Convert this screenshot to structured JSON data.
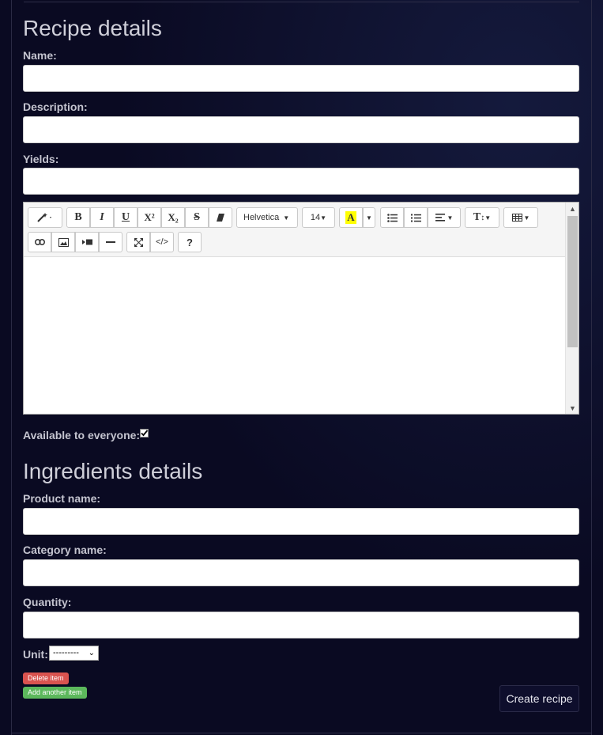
{
  "recipe": {
    "heading": "Recipe details",
    "name_label": "Name:",
    "description_label": "Description:",
    "yields_label": "Yields:",
    "available_label": "Available to everyone:",
    "available_checked": true
  },
  "editor": {
    "font_name": "Helvetica",
    "font_size": "14",
    "icons": [
      "magic-wand-icon",
      "bold-icon",
      "italic-icon",
      "underline-icon",
      "superscript-icon",
      "subscript-icon",
      "strikethrough-icon",
      "eraser-icon",
      "font-family-dropdown",
      "font-size-dropdown",
      "text-color-icon",
      "dropdown-caret-icon",
      "unordered-list-icon",
      "ordered-list-icon",
      "align-icon",
      "line-height-icon",
      "table-icon",
      "link-icon",
      "picture-icon",
      "video-icon",
      "horizontal-rule-icon",
      "fullscreen-icon",
      "code-view-icon",
      "help-icon"
    ],
    "glyphs": {
      "bold": "B",
      "italic": "I",
      "underline": "U",
      "superscript": "X²",
      "subscript": "X₂",
      "strike": "S",
      "help": "?"
    }
  },
  "ingredients": {
    "heading": "Ingredients details",
    "product_label": "Product name:",
    "category_label": "Category name:",
    "quantity_label": "Quantity:",
    "unit_label": "Unit:",
    "unit_selected": "---------",
    "delete_label": "Delete item",
    "add_label": "Add another item"
  },
  "actions": {
    "create_label": "Create recipe"
  },
  "colors": {
    "background": "#0a0a22",
    "delete": "#d9534f",
    "add": "#5cb85c",
    "highlight": "#ffff00"
  }
}
